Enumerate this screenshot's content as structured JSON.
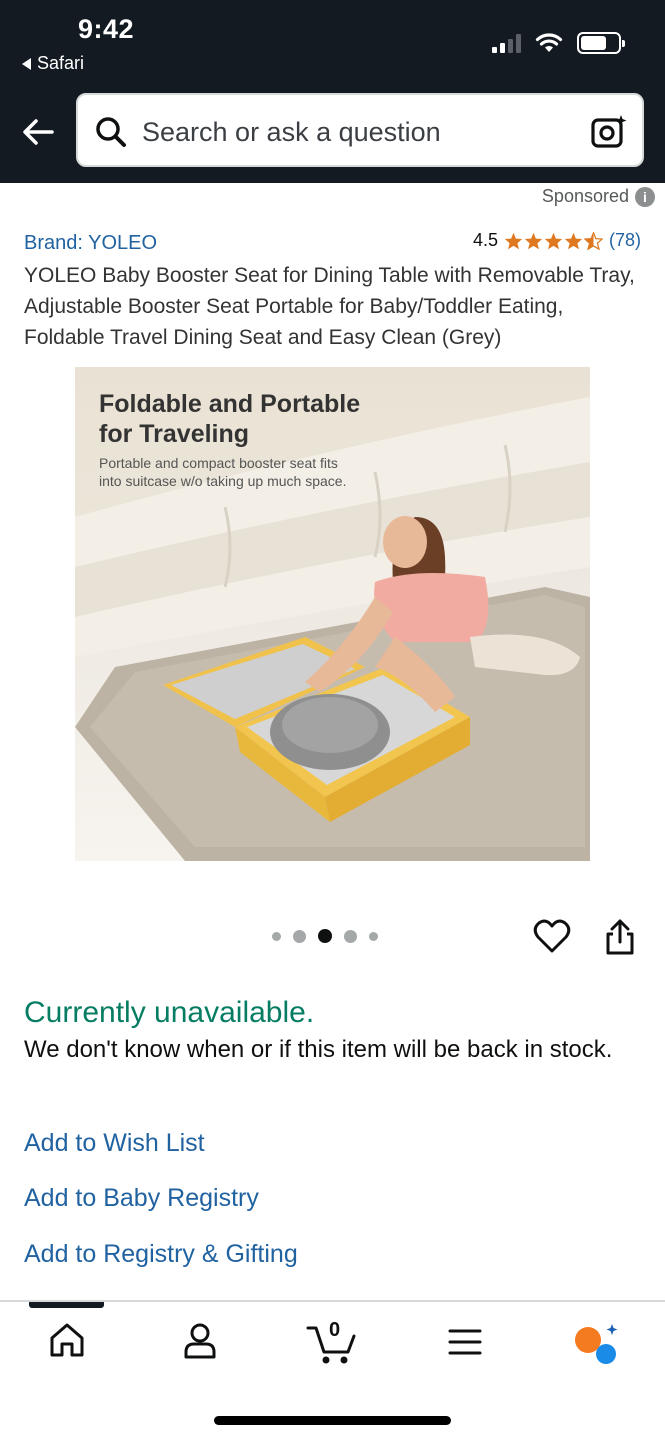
{
  "status_bar": {
    "time": "9:42",
    "back_app": "Safari"
  },
  "search": {
    "placeholder": "Search or ask a question"
  },
  "sponsored": {
    "label": "Sponsored",
    "info_glyph": "i"
  },
  "product": {
    "brand": "Brand: YOLEO",
    "rating": "4.5",
    "review_count": "(78)",
    "stars": 4.5,
    "title": "YOLEO Baby Booster Seat for Dining Table with Removable Tray, Adjustable Booster Seat Portable for Baby/Toddler Eating, Foldable Travel Dining Seat and Easy Clean (Grey)",
    "image_heading_line1": "Foldable and Portable",
    "image_heading_line2": "for Traveling",
    "image_subtext": "Portable and compact booster seat fits into suitcase w/o taking up much space."
  },
  "carousel": {
    "count": 5,
    "active_index": 2
  },
  "availability": {
    "status": "Currently unavailable.",
    "detail": "We don't know when or if this item will be back in stock."
  },
  "links": {
    "wish_list": "Add to Wish List",
    "baby_registry": "Add to Baby Registry",
    "registry_gifting": "Add to Registry & Gifting"
  },
  "bottom_nav": {
    "cart_count": "0",
    "items": [
      "home-icon",
      "account-icon",
      "cart-icon",
      "menu-icon",
      "rufus-icon"
    ]
  },
  "colors": {
    "header_bg": "#131a22",
    "link": "#2162a1",
    "star": "#de7921",
    "unavailable": "#067d62"
  }
}
